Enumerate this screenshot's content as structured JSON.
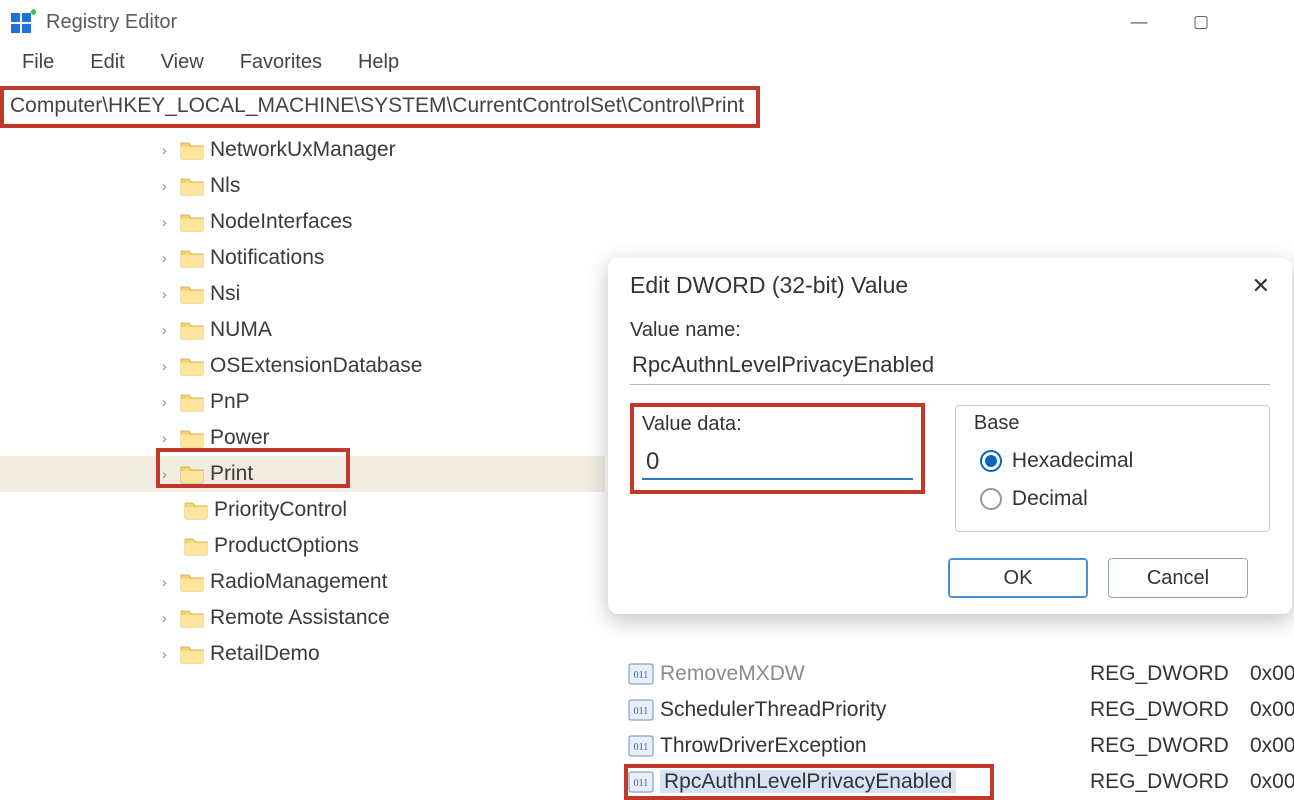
{
  "window": {
    "title": "Registry Editor",
    "controls": {
      "minimize": "—",
      "maximize": "▢",
      "close": ""
    }
  },
  "menu": {
    "file": "File",
    "edit": "Edit",
    "view": "View",
    "favorites": "Favorites",
    "help": "Help"
  },
  "address": "Computer\\HKEY_LOCAL_MACHINE\\SYSTEM\\CurrentControlSet\\Control\\Print",
  "tree": [
    {
      "label": "NetworkUxManager",
      "expandable": true
    },
    {
      "label": "Nls",
      "expandable": true
    },
    {
      "label": "NodeInterfaces",
      "expandable": true
    },
    {
      "label": "Notifications",
      "expandable": true
    },
    {
      "label": "Nsi",
      "expandable": true
    },
    {
      "label": "NUMA",
      "expandable": true
    },
    {
      "label": "OSExtensionDatabase",
      "expandable": true
    },
    {
      "label": "PnP",
      "expandable": true
    },
    {
      "label": "Power",
      "expandable": true
    },
    {
      "label": "Print",
      "expandable": true,
      "selected": true
    },
    {
      "label": "PriorityControl",
      "expandable": false
    },
    {
      "label": "ProductOptions",
      "expandable": false
    },
    {
      "label": "RadioManagement",
      "expandable": true
    },
    {
      "label": "Remote Assistance",
      "expandable": true
    },
    {
      "label": "RetailDemo",
      "expandable": true
    }
  ],
  "dialog": {
    "title": "Edit DWORD (32-bit) Value",
    "value_name_label": "Value name:",
    "value_name": "RpcAuthnLevelPrivacyEnabled",
    "value_data_label": "Value data:",
    "value_data": "0",
    "base_label": "Base",
    "hex_label": "Hexadecimal",
    "dec_label": "Decimal",
    "base_selected": "hex",
    "ok": "OK",
    "cancel": "Cancel"
  },
  "values": [
    {
      "name": "RemoveMXDW",
      "type": "REG_DWORD",
      "data": "0x00",
      "cut": true
    },
    {
      "name": "SchedulerThreadPriority",
      "type": "REG_DWORD",
      "data": "0x00"
    },
    {
      "name": "ThrowDriverException",
      "type": "REG_DWORD",
      "data": "0x00"
    },
    {
      "name": "RpcAuthnLevelPrivacyEnabled",
      "type": "REG_DWORD",
      "data": "0x00",
      "selected": true
    }
  ]
}
